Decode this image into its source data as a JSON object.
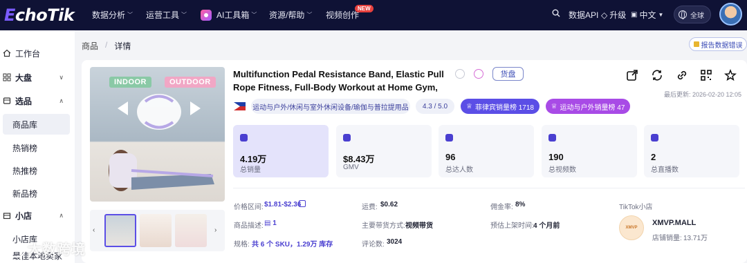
{
  "brand": {
    "logo_text": "EchoTik"
  },
  "nav": {
    "items": [
      "数据分析",
      "运营工具",
      "AI工具箱",
      "资源/帮助",
      "视频创作"
    ],
    "new_badge": "NEW",
    "data_api": "数据API",
    "upgrade": "升级",
    "language": "中文",
    "region": "全球"
  },
  "sidebar": {
    "workbench": "工作台",
    "dashboard": "大盘",
    "selection": "选品",
    "selection_sub": [
      "商品库",
      "热销榜",
      "热推榜",
      "新品榜"
    ],
    "shop": "小店",
    "shop_sub": [
      "小店库",
      "最佳本地卖家"
    ]
  },
  "breadcrumb": [
    "商品",
    "详情"
  ],
  "report_button": "报告数据错误",
  "product": {
    "title": "Multifunction Pedal Resistance Band, Elastic Pull Rope Fitness, Full-Body Workout at Home Gym, Exercise Sit-...",
    "goods_button": "货盘",
    "last_updated": "最后更新: 2026-02-20 12:05",
    "category": "运动与户外/休闲与室外休闲设备/瑜伽与普拉提用品",
    "rating": "4.3 / 5.0",
    "rank_ph": "菲律宾销量榜  1718",
    "rank_sports": "运动与户外销量榜  47",
    "image_tags": {
      "indoor": "INDOOR",
      "outdoor": "OUTDOOR"
    }
  },
  "stats": [
    {
      "value": "4.19万",
      "label": "总销量"
    },
    {
      "value": "$8.43万",
      "label": "GMV"
    },
    {
      "value": "96",
      "label": "总达人数"
    },
    {
      "value": "190",
      "label": "总视频数"
    },
    {
      "value": "2",
      "label": "总直播数"
    }
  ],
  "details": {
    "price_label": "价格区间:",
    "price_value": "$1.81-$2.36",
    "shipping_label": "运费:",
    "shipping_value": "$0.62",
    "commission_label": "佣金率:",
    "commission_value": "8%",
    "desc_label": "商品描述:",
    "desc_value": "1",
    "mode_label": "主要带货方式:",
    "mode_value": "视频带货",
    "listed_label": "预估上架时间:",
    "listed_value": "4 个月前",
    "spec_label": "规格:",
    "spec_value": "共 6 个 SKU，1.29万 库存",
    "reviews_label": "评论数:",
    "reviews_value": "3024"
  },
  "shop": {
    "section_label": "TikTok小店",
    "logo_text": "XMVP",
    "name": "XMVP.MALL",
    "sales_label": "店铺销量:",
    "sales_value": "13.71万"
  },
  "watermark": "大数跨境",
  "colors": {
    "nav_bg": "#0f1235",
    "accent": "#4a3fd0",
    "rank1": "#5b4ee6",
    "rank2": "#a84be6"
  }
}
